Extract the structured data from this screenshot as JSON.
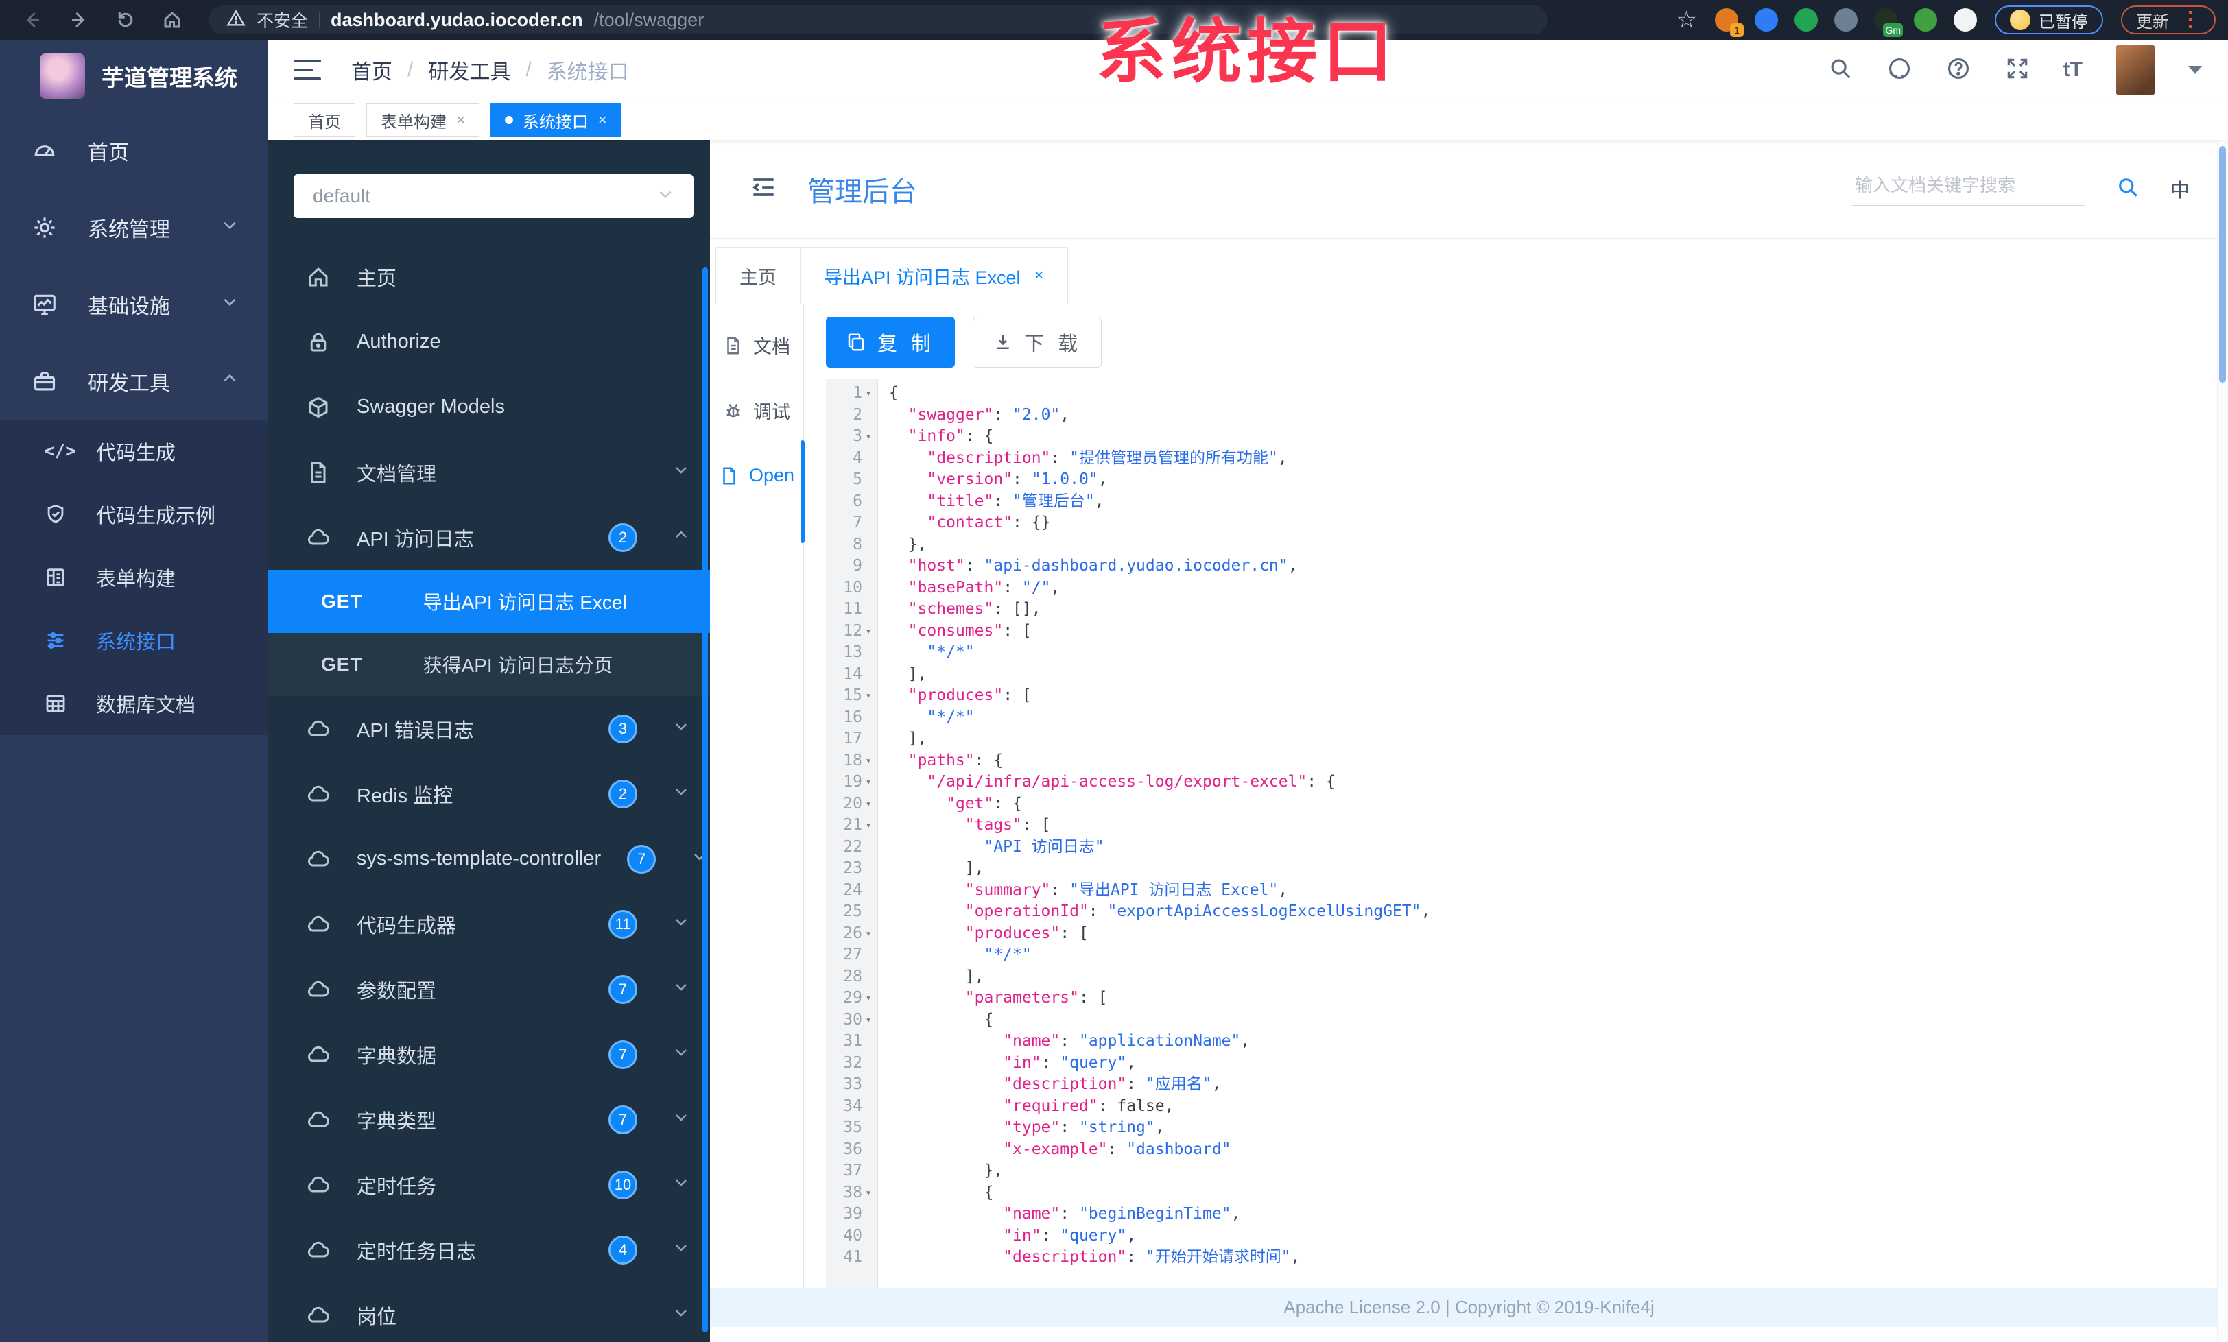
{
  "colors": {
    "accent": "#0d84fa",
    "main_sidebar_bg": "#2c3b5c",
    "swagger_sidebar_bg": "#1e3142",
    "tag_active_bg": "#0e84f8",
    "watermark_red": "#fb3550",
    "footer_bg": "#e9f5fe",
    "code_key_pink": "#e0218a",
    "code_string_blue": "#2b6de8"
  },
  "browser": {
    "insecure_label": "不安全",
    "url_host": "dashboard.yudao.iocoder.cn",
    "url_path": "/tool/swagger",
    "paused_label": "已暂停",
    "update_label": "更新",
    "extensions": [
      {
        "name": "extension-icon",
        "color": "#e0791f",
        "badge": "1",
        "badge_color": "orange"
      },
      {
        "name": "extension-icon",
        "color": "#2f7cf6",
        "badge": ""
      },
      {
        "name": "extension-icon",
        "color": "#21a453",
        "badge": ""
      },
      {
        "name": "extension-icon",
        "color": "#6b7f95",
        "badge": ""
      },
      {
        "name": "extension-icon",
        "color": "#233024",
        "badge": "Gm",
        "badge_color": "green"
      },
      {
        "name": "extension-icon",
        "color": "#3fa142",
        "badge": ""
      },
      {
        "name": "extension-icon",
        "color": "#f2f3f5",
        "badge": ""
      }
    ]
  },
  "watermark": "系统接口",
  "app_sidebar": {
    "logo_title": "芋道管理系统",
    "items": [
      {
        "label": "首页",
        "icon": "gauge-icon",
        "chevron": ""
      },
      {
        "label": "系统管理",
        "icon": "gear-icon",
        "chevron": "down"
      },
      {
        "label": "基础设施",
        "icon": "monitor-icon",
        "chevron": "down"
      },
      {
        "label": "研发工具",
        "icon": "toolbox-icon",
        "chevron": "up"
      }
    ],
    "sub_items": [
      {
        "label": "代码生成",
        "icon": "code-icon",
        "active": false
      },
      {
        "label": "代码生成示例",
        "icon": "shield-icon",
        "active": false
      },
      {
        "label": "表单构建",
        "icon": "form-icon",
        "active": false
      },
      {
        "label": "系统接口",
        "icon": "sliders-icon",
        "active": true
      },
      {
        "label": "数据库文档",
        "icon": "table-icon",
        "active": false
      }
    ]
  },
  "header": {
    "breadcrumb": [
      "首页",
      "研发工具",
      "系统接口"
    ]
  },
  "tags": [
    {
      "label": "首页",
      "closable": false,
      "active": false
    },
    {
      "label": "表单构建",
      "closable": true,
      "active": false
    },
    {
      "label": "系统接口",
      "closable": true,
      "active": true
    }
  ],
  "swagger_sidebar": {
    "group_select": "default",
    "items": [
      {
        "type": "item",
        "label": "主页",
        "icon": "home-icon",
        "badge": "",
        "chevron": ""
      },
      {
        "type": "item",
        "label": "Authorize",
        "icon": "lock-icon",
        "badge": "",
        "chevron": ""
      },
      {
        "type": "item",
        "label": "Swagger Models",
        "icon": "cube-icon",
        "badge": "",
        "chevron": ""
      },
      {
        "type": "item",
        "label": "文档管理",
        "icon": "doc-icon",
        "badge": "",
        "chevron": "down"
      },
      {
        "type": "item",
        "label": "API 访问日志",
        "icon": "cloud-icon",
        "badge": "2",
        "chevron": "up"
      },
      {
        "type": "op",
        "method": "GET",
        "label": "导出API 访问日志 Excel",
        "selected": true
      },
      {
        "type": "op",
        "method": "GET",
        "label": "获得API 访问日志分页",
        "selected": false
      },
      {
        "type": "item",
        "label": "API 错误日志",
        "icon": "cloud-icon",
        "badge": "3",
        "chevron": "down"
      },
      {
        "type": "item",
        "label": "Redis 监控",
        "icon": "cloud-icon",
        "badge": "2",
        "chevron": "down"
      },
      {
        "type": "item",
        "label": "sys-sms-template-controller",
        "icon": "cloud-icon",
        "badge": "7",
        "chevron": "down"
      },
      {
        "type": "item",
        "label": "代码生成器",
        "icon": "cloud-icon",
        "badge": "11",
        "chevron": "down"
      },
      {
        "type": "item",
        "label": "参数配置",
        "icon": "cloud-icon",
        "badge": "7",
        "chevron": "down"
      },
      {
        "type": "item",
        "label": "字典数据",
        "icon": "cloud-icon",
        "badge": "7",
        "chevron": "down"
      },
      {
        "type": "item",
        "label": "字典类型",
        "icon": "cloud-icon",
        "badge": "7",
        "chevron": "down"
      },
      {
        "type": "item",
        "label": "定时任务",
        "icon": "cloud-icon",
        "badge": "10",
        "chevron": "down"
      },
      {
        "type": "item",
        "label": "定时任务日志",
        "icon": "cloud-icon",
        "badge": "4",
        "chevron": "down"
      },
      {
        "type": "item",
        "label": "岗位",
        "icon": "cloud-icon",
        "badge": "",
        "chevron": "down"
      }
    ]
  },
  "doc": {
    "title": "管理后台",
    "search_placeholder": "输入文档关键字搜索",
    "lang_toggle": "中",
    "tabs": [
      {
        "label": "主页",
        "closable": false,
        "active": false
      },
      {
        "label": "导出API 访问日志 Excel",
        "closable": true,
        "active": true
      }
    ],
    "mini_nav": [
      {
        "label": "文档",
        "icon": "doc-icon",
        "active": false
      },
      {
        "label": "调试",
        "icon": "bug-icon",
        "active": false
      },
      {
        "label": "Open",
        "icon": "file-icon",
        "active": true
      }
    ],
    "toolbar": {
      "copy_label": "复 制",
      "download_label": "下 载"
    },
    "code": {
      "fold_lines": [
        1,
        3,
        12,
        15,
        18,
        19,
        20,
        21,
        26,
        29,
        30,
        38
      ],
      "lines": [
        "{",
        "  \"swagger\": \"2.0\",",
        "  \"info\": {",
        "    \"description\": \"提供管理员管理的所有功能\",",
        "    \"version\": \"1.0.0\",",
        "    \"title\": \"管理后台\",",
        "    \"contact\": {}",
        "  },",
        "  \"host\": \"api-dashboard.yudao.iocoder.cn\",",
        "  \"basePath\": \"/\",",
        "  \"schemes\": [],",
        "  \"consumes\": [",
        "    \"*/*\"",
        "  ],",
        "  \"produces\": [",
        "    \"*/*\"",
        "  ],",
        "  \"paths\": {",
        "    \"/api/infra/api-access-log/export-excel\": {",
        "      \"get\": {",
        "        \"tags\": [",
        "          \"API 访问日志\"",
        "        ],",
        "        \"summary\": \"导出API 访问日志 Excel\",",
        "        \"operationId\": \"exportApiAccessLogExcelUsingGET\",",
        "        \"produces\": [",
        "          \"*/*\"",
        "        ],",
        "        \"parameters\": [",
        "          {",
        "            \"name\": \"applicationName\",",
        "            \"in\": \"query\",",
        "            \"description\": \"应用名\",",
        "            \"required\": false,",
        "            \"type\": \"string\",",
        "            \"x-example\": \"dashboard\"",
        "          },",
        "          {",
        "            \"name\": \"beginBeginTime\",",
        "            \"in\": \"query\",",
        "            \"description\": \"开始开始请求时间\","
      ]
    },
    "footer": "Apache License 2.0 | Copyright © 2019-Knife4j"
  }
}
